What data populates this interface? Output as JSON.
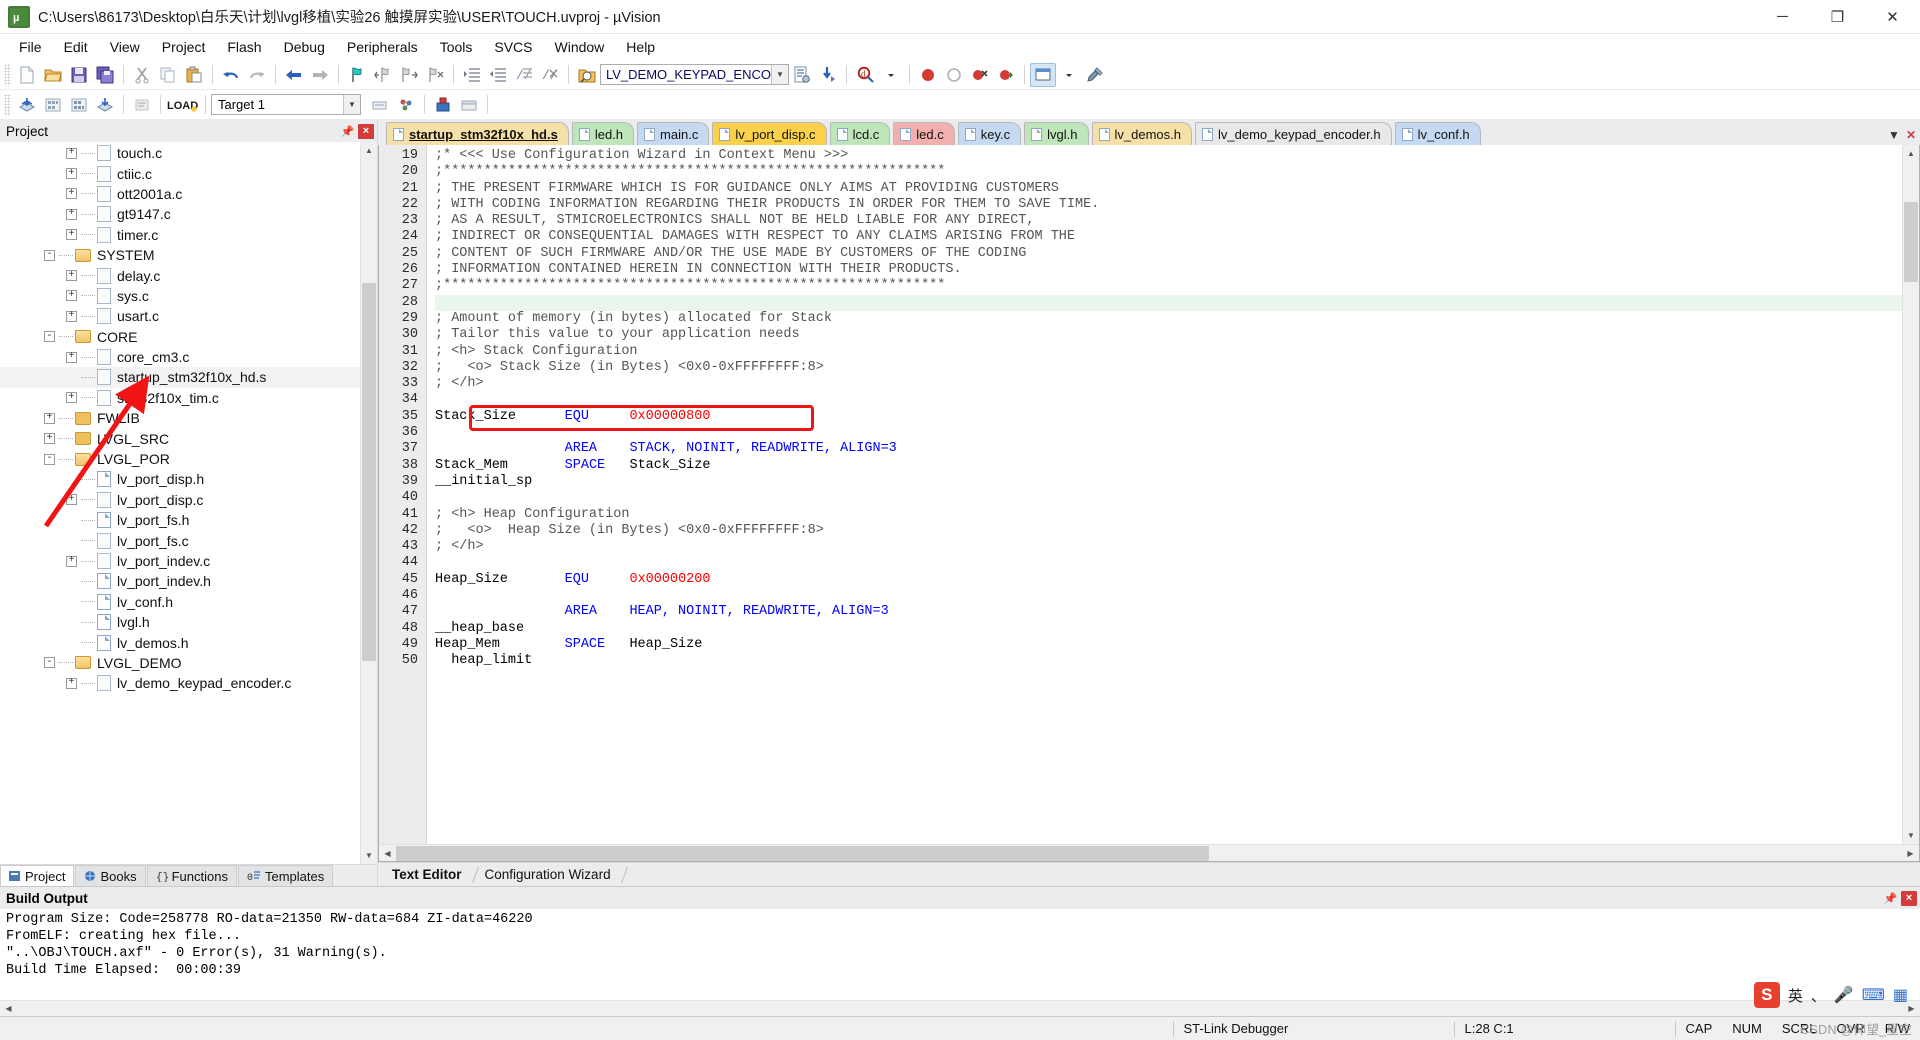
{
  "window": {
    "title": "C:\\Users\\86173\\Desktop\\白乐天\\计划\\lvgl移植\\实验26 触摸屏实验\\USER\\TOUCH.uvproj - µVision",
    "app_icon": "uvision-icon",
    "minimize": "─",
    "maximize": "❐",
    "close": "✕"
  },
  "menubar": {
    "items": [
      "File",
      "Edit",
      "View",
      "Project",
      "Flash",
      "Debug",
      "Peripherals",
      "Tools",
      "SVCS",
      "Window",
      "Help"
    ]
  },
  "toolbar1": {
    "target_combo_value": "LV_DEMO_KEYPAD_ENCO",
    "icons": [
      "new-file-icon",
      "open-folder-icon",
      "save-icon",
      "save-all-icon",
      "cut-icon",
      "copy-icon",
      "paste-icon",
      "undo-icon",
      "redo-icon",
      "back-icon",
      "forward-icon",
      "bookmark-toggle-icon",
      "bookmark-prev-icon",
      "bookmark-next-icon",
      "bookmark-clear-icon",
      "indent-icon",
      "outdent-icon",
      "comment-icon",
      "uncomment-icon",
      "project-targets-icon",
      "target-options-icon",
      "download-icon",
      "find-in-files-icon",
      "start-debug-icon",
      "insert-breakpoint-icon",
      "kill-breakpoints-icon",
      "disable-breakpoints-icon",
      "window-layout-icon",
      "configure-icon"
    ]
  },
  "toolbar2": {
    "target_value": "Target 1",
    "icons": [
      "build-icon",
      "rebuild-icon",
      "batch-build-icon",
      "translate-icon",
      "stop-build-icon",
      "load-icon",
      "manage-project-icon",
      "manage-runtime-icon"
    ]
  },
  "project_panel": {
    "title": "Project",
    "pin_icon": "pin-icon",
    "close_icon": "close-icon",
    "tree": [
      {
        "label": "touch.c",
        "type": "file",
        "indent": 2,
        "expander": "+"
      },
      {
        "label": "ctiic.c",
        "type": "file",
        "indent": 2,
        "expander": "+"
      },
      {
        "label": "ott2001a.c",
        "type": "file",
        "indent": 2,
        "expander": "+"
      },
      {
        "label": "gt9147.c",
        "type": "file",
        "indent": 2,
        "expander": "+"
      },
      {
        "label": "timer.c",
        "type": "file",
        "indent": 2,
        "expander": "+"
      },
      {
        "label": "SYSTEM",
        "type": "folder-open",
        "indent": 1,
        "expander": "-"
      },
      {
        "label": "delay.c",
        "type": "file",
        "indent": 2,
        "expander": "+"
      },
      {
        "label": "sys.c",
        "type": "file",
        "indent": 2,
        "expander": "+"
      },
      {
        "label": "usart.c",
        "type": "file",
        "indent": 2,
        "expander": "+"
      },
      {
        "label": "CORE",
        "type": "folder-open",
        "indent": 1,
        "expander": "-"
      },
      {
        "label": "core_cm3.c",
        "type": "file",
        "indent": 2,
        "expander": "+"
      },
      {
        "label": "startup_stm32f10x_hd.s",
        "type": "file",
        "indent": 2,
        "expander": "",
        "selected": true
      },
      {
        "label": "stm32f10x_tim.c",
        "type": "file",
        "indent": 2,
        "expander": "+"
      },
      {
        "label": "FWLIB",
        "type": "folder",
        "indent": 1,
        "expander": "+"
      },
      {
        "label": "LVGL_SRC",
        "type": "folder",
        "indent": 1,
        "expander": "+"
      },
      {
        "label": "LVGL_POR",
        "type": "folder-open",
        "indent": 1,
        "expander": "-"
      },
      {
        "label": "lv_port_disp.h",
        "type": "file-h",
        "indent": 2,
        "expander": ""
      },
      {
        "label": "lv_port_disp.c",
        "type": "file",
        "indent": 2,
        "expander": "+"
      },
      {
        "label": "lv_port_fs.h",
        "type": "file-h",
        "indent": 2,
        "expander": ""
      },
      {
        "label": "lv_port_fs.c",
        "type": "file",
        "indent": 2,
        "expander": ""
      },
      {
        "label": "lv_port_indev.c",
        "type": "file",
        "indent": 2,
        "expander": "+"
      },
      {
        "label": "lv_port_indev.h",
        "type": "file-h",
        "indent": 2,
        "expander": ""
      },
      {
        "label": "lv_conf.h",
        "type": "file-h",
        "indent": 2,
        "expander": ""
      },
      {
        "label": "lvgl.h",
        "type": "file-h",
        "indent": 2,
        "expander": ""
      },
      {
        "label": "lv_demos.h",
        "type": "file-h",
        "indent": 2,
        "expander": ""
      },
      {
        "label": "LVGL_DEMO",
        "type": "folder-open",
        "indent": 1,
        "expander": "-"
      },
      {
        "label": "lv_demo_keypad_encoder.c",
        "type": "file",
        "indent": 2,
        "expander": "+"
      }
    ],
    "bottom_tabs": [
      {
        "label": "Project",
        "icon": "project-icon",
        "active": true
      },
      {
        "label": "Books",
        "icon": "books-icon",
        "active": false
      },
      {
        "label": "Functions",
        "icon": "functions-icon",
        "active": false
      },
      {
        "label": "Templates",
        "icon": "templates-icon",
        "active": false
      }
    ]
  },
  "editor": {
    "tabs": [
      {
        "label": "startup_stm32f10x_hd.s",
        "color": "#f5e0a8",
        "active": true
      },
      {
        "label": "led.h",
        "color": "#bfe6bb",
        "active": false
      },
      {
        "label": "main.c",
        "color": "#c5d9f1",
        "active": false
      },
      {
        "label": "lv_port_disp.c",
        "color": "#fbd04a",
        "active": false
      },
      {
        "label": "lcd.c",
        "color": "#bfe6bb",
        "active": false
      },
      {
        "label": "led.c",
        "color": "#f3aeae",
        "active": false
      },
      {
        "label": "key.c",
        "color": "#c5d9f1",
        "active": false
      },
      {
        "label": "lvgl.h",
        "color": "#bfe6bb",
        "active": false
      },
      {
        "label": "lv_demos.h",
        "color": "#f5e0a8",
        "active": false
      },
      {
        "label": "lv_demo_keypad_encoder.h",
        "color": "#e8e8e8",
        "active": false
      },
      {
        "label": "lv_conf.h",
        "color": "#c5d9f1",
        "active": false
      }
    ],
    "tab_controls": {
      "menu": "▼",
      "close": "✕"
    },
    "lines": [
      {
        "n": 19,
        "text": ";* <<< Use Configuration Wizard in Context Menu >>>",
        "style": "comment"
      },
      {
        "n": 20,
        "text": ";**************************************************************",
        "style": "comment"
      },
      {
        "n": 21,
        "text": "; THE PRESENT FIRMWARE WHICH IS FOR GUIDANCE ONLY AIMS AT PROVIDING CUSTOMERS",
        "style": "comment"
      },
      {
        "n": 22,
        "text": "; WITH CODING INFORMATION REGARDING THEIR PRODUCTS IN ORDER FOR THEM TO SAVE TIME.",
        "style": "comment"
      },
      {
        "n": 23,
        "text": "; AS A RESULT, STMICROELECTRONICS SHALL NOT BE HELD LIABLE FOR ANY DIRECT,",
        "style": "comment"
      },
      {
        "n": 24,
        "text": "; INDIRECT OR CONSEQUENTIAL DAMAGES WITH RESPECT TO ANY CLAIMS ARISING FROM THE",
        "style": "comment"
      },
      {
        "n": 25,
        "text": "; CONTENT OF SUCH FIRMWARE AND/OR THE USE MADE BY CUSTOMERS OF THE CODING",
        "style": "comment"
      },
      {
        "n": 26,
        "text": "; INFORMATION CONTAINED HEREIN IN CONNECTION WITH THEIR PRODUCTS.",
        "style": "comment"
      },
      {
        "n": 27,
        "text": ";**************************************************************",
        "style": "comment"
      },
      {
        "n": 28,
        "text": "",
        "style": "blank",
        "highlight": true
      },
      {
        "n": 29,
        "text": "; Amount of memory (in bytes) allocated for Stack",
        "style": "comment"
      },
      {
        "n": 30,
        "text": "; Tailor this value to your application needs",
        "style": "comment"
      },
      {
        "n": 31,
        "text": "; <h> Stack Configuration",
        "style": "comment"
      },
      {
        "n": 32,
        "text": ";   <o> Stack Size (in Bytes) <0x0-0xFFFFFFFF:8>",
        "style": "comment"
      },
      {
        "n": 33,
        "text": "; </h>",
        "style": "comment"
      },
      {
        "n": 34,
        "text": "",
        "style": "blank"
      },
      {
        "n": 35,
        "text": "Stack_Size      EQU     0x00000800",
        "style": "equ",
        "boxed": true
      },
      {
        "n": 36,
        "text": "",
        "style": "blank"
      },
      {
        "n": 37,
        "text": "                AREA    STACK, NOINIT, READWRITE, ALIGN=3",
        "style": "area"
      },
      {
        "n": 38,
        "text": "Stack_Mem       SPACE   Stack_Size",
        "style": "space"
      },
      {
        "n": 39,
        "text": "__initial_sp",
        "style": "plain"
      },
      {
        "n": 40,
        "text": "",
        "style": "blank"
      },
      {
        "n": 41,
        "text": "; <h> Heap Configuration",
        "style": "comment"
      },
      {
        "n": 42,
        "text": ";   <o>  Heap Size (in Bytes) <0x0-0xFFFFFFFF:8>",
        "style": "comment"
      },
      {
        "n": 43,
        "text": "; </h>",
        "style": "comment"
      },
      {
        "n": 44,
        "text": "",
        "style": "blank"
      },
      {
        "n": 45,
        "text": "Heap_Size       EQU     0x00000200",
        "style": "equ2"
      },
      {
        "n": 46,
        "text": "",
        "style": "blank"
      },
      {
        "n": 47,
        "text": "                AREA    HEAP, NOINIT, READWRITE, ALIGN=3",
        "style": "area2"
      },
      {
        "n": 48,
        "text": "__heap_base",
        "style": "plain"
      },
      {
        "n": 49,
        "text": "Heap_Mem        SPACE   Heap_Size",
        "style": "space2"
      },
      {
        "n": 50,
        "text": "  heap_limit",
        "style": "plain"
      }
    ],
    "bottom_tabs": [
      {
        "label": "Text Editor",
        "active": true
      },
      {
        "label": "Configuration Wizard",
        "active": false
      }
    ]
  },
  "build_output": {
    "title": "Build Output",
    "pin_icon": "pin-icon",
    "close_icon": "close-icon",
    "lines": [
      "Program Size: Code=258778 RO-data=21350 RW-data=684 ZI-data=46220",
      "FromELF: creating hex file...",
      "\"..\\OBJ\\TOUCH.axf\" - 0 Error(s), 31 Warning(s).",
      "Build Time Elapsed:  00:00:39"
    ]
  },
  "statusbar": {
    "debugger": "ST-Link Debugger",
    "cursor": "L:28 C:1",
    "caps": "CAP",
    "num": "NUM",
    "scrl": "SCRL",
    "ovr": "OVR",
    "rw": "R/W"
  },
  "ime": {
    "logo": "S",
    "mode": "英",
    "punct": "、",
    "mic_icon": "mic-icon",
    "keyboard_icon": "keyboard-icon",
    "grid_icon": "grid-icon"
  },
  "watermark": "CSDN @仰望_星空",
  "colors": {
    "accent": "#f01414",
    "comment": "#555555",
    "keyword": "#0000ff",
    "number": "#ff0000",
    "highlight": "#e9f6ec",
    "titlebar": "#ffffff",
    "panel": "#ebecee"
  }
}
